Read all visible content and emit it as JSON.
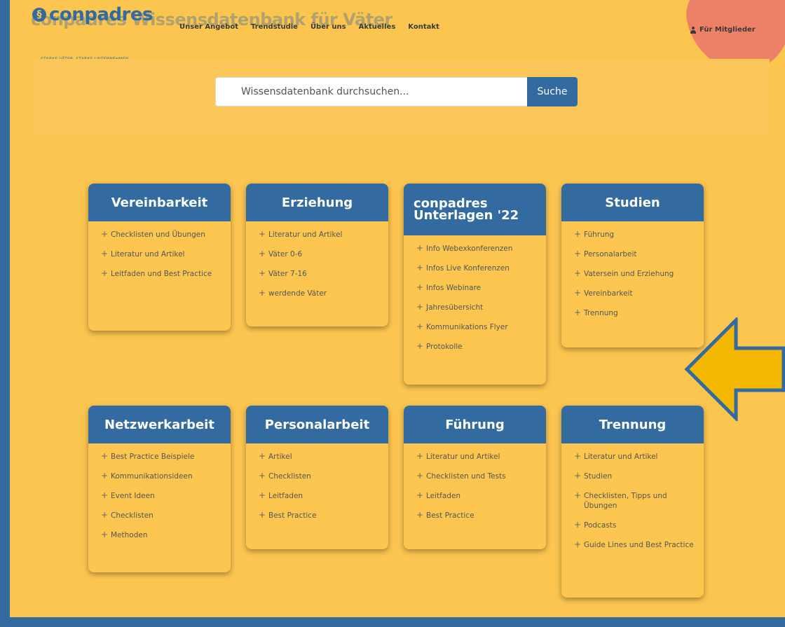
{
  "header": {
    "logo_glyph": "§",
    "logo_text": "conpadres",
    "tagline": "STARKE VÄTER. STARKE UNTERNEHMEN.",
    "ghost_title": "conpadres Wissensdatenbank für Väter",
    "nav": [
      "Unser Angebot",
      "Trendstudie",
      "Über uns",
      "Aktuelles",
      "Kontakt"
    ],
    "member_label": "Für Mitglieder",
    "member_icon": "user-icon"
  },
  "search": {
    "placeholder": "Wissensdatenbank durchsuchen...",
    "button_label": "Suche"
  },
  "cards": [
    {
      "title": "Vereinbarkeit",
      "items": [
        "Checklisten und Übungen",
        "Literatur und Artikel",
        "Leitfaden und Best Practice"
      ]
    },
    {
      "title": "Erziehung",
      "items": [
        "Literatur und Artikel",
        "Väter 0-6",
        "Väter 7-16",
        "werdende Väter"
      ]
    },
    {
      "title": "conpadres Unterlagen '22",
      "items": [
        "Info Webexkonferenzen",
        "Infos Live Konferenzen",
        "Infos Webinare",
        "Jahresübersicht",
        "Kommunikations Flyer",
        "Protokolle"
      ]
    },
    {
      "title": "Studien",
      "items": [
        "Führung",
        "Personalarbeit",
        "Vatersein und Erziehung",
        "Vereinbarkeit",
        "Trennung"
      ]
    },
    {
      "title": "Netzwerkarbeit",
      "items": [
        "Best Practice Beispiele",
        "Kommunikationsideen",
        "Event Ideen",
        "Checklisten",
        "Methoden"
      ]
    },
    {
      "title": "Personalarbeit",
      "items": [
        "Artikel",
        "Checklisten",
        "Leitfaden",
        "Best Practice"
      ]
    },
    {
      "title": "Führung",
      "items": [
        "Literatur und Artikel",
        "Checklisten und Tests",
        "Leitfaden",
        "Best Practice"
      ]
    },
    {
      "title": "Trennung",
      "items": [
        "Literatur und Artikel",
        "Studien",
        "Checklisten, Tipps und Übungen",
        "Podcasts",
        "Guide Lines und Best Practice"
      ]
    }
  ],
  "colors": {
    "background": "#fcc54f",
    "frame": "#336aa0",
    "card_header": "#336aa0",
    "arrow_fill": "#f5b800",
    "member_blob": "#ef8068"
  }
}
